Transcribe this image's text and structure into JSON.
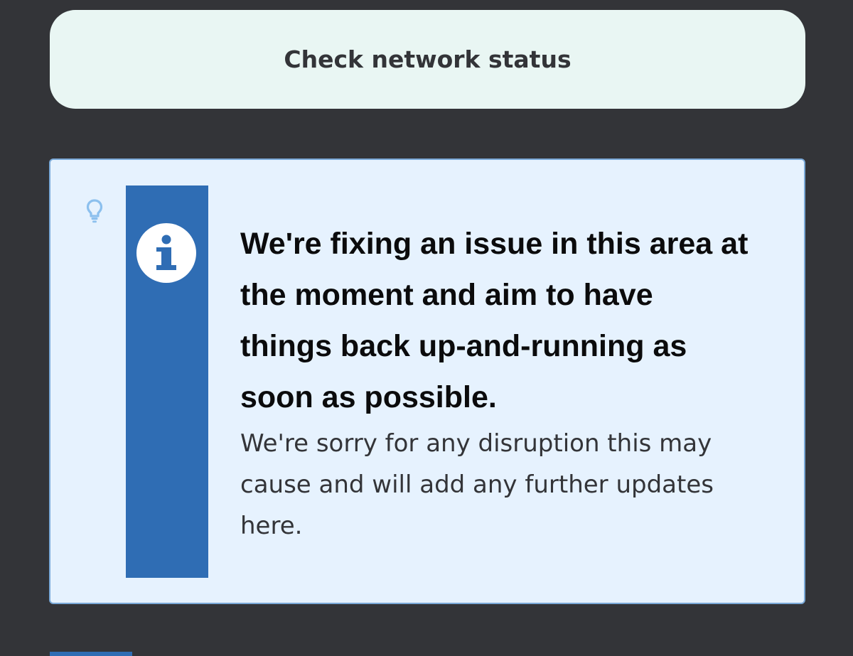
{
  "network_button": {
    "label": "Check network status"
  },
  "notice": {
    "heading": "We're fixing an issue in this area at the moment and aim to have things back up-and-running as soon as possible.",
    "body": "We're sorry for any disruption this may cause and will add any further updates here.",
    "icon": "info-icon",
    "side_icon": "lightbulb-icon"
  },
  "colors": {
    "page_background": "#333438",
    "button_background": "#e9f6f3",
    "notice_background": "#e6f2fe",
    "notice_border": "#7aa9d8",
    "accent": "#2f6db4"
  }
}
